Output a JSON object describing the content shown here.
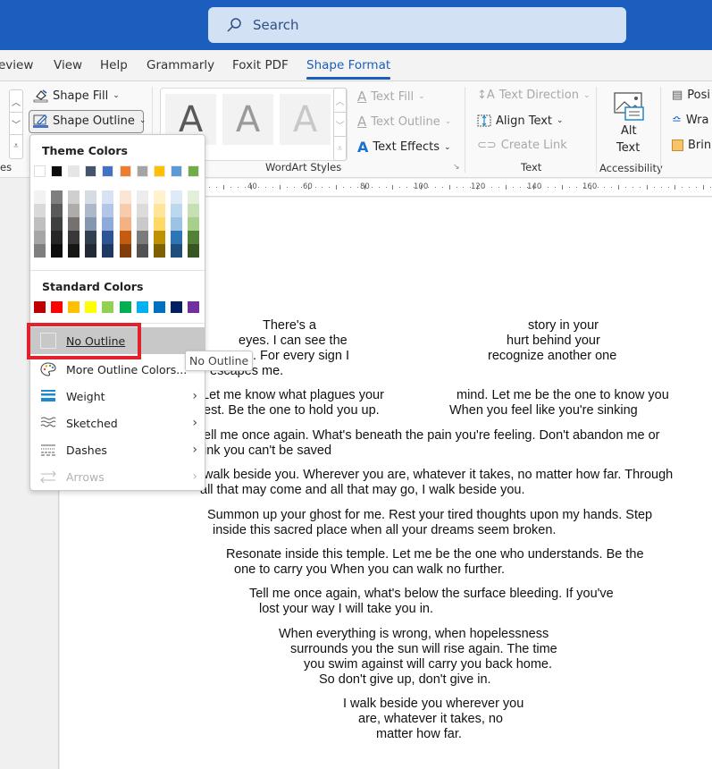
{
  "titlebar": {
    "search_placeholder": "Search"
  },
  "tabs": [
    {
      "label": "Review",
      "visible_label": "eview"
    },
    {
      "label": "View"
    },
    {
      "label": "Help"
    },
    {
      "label": "Grammarly"
    },
    {
      "label": "Foxit PDF"
    },
    {
      "label": "Shape Format",
      "active": true
    }
  ],
  "ribbon": {
    "shape_fill": "Shape Fill",
    "shape_outline": "Shape Outline",
    "shape_styles_label_partial": "es",
    "wordart_styles": {
      "label": "WordArt Styles",
      "samples": [
        "A",
        "A",
        "A"
      ]
    },
    "text_fill": "Text Fill",
    "text_outline": "Text Outline",
    "text_effects": "Text Effects",
    "text_direction": "Text Direction",
    "align_text": "Align Text",
    "create_link": "Create Link",
    "text_group_label": "Text",
    "alt_text_line1": "Alt",
    "alt_text_line2": "Text",
    "accessibility_label": "Accessibility",
    "position": "Posi",
    "wrap_text": "Wra",
    "bring_forward": "Brin"
  },
  "ruler": {
    "labels": [
      "40",
      "60",
      "80",
      "100",
      "120",
      "140",
      "160"
    ]
  },
  "dropdown": {
    "theme_colors_heading": "Theme Colors",
    "theme_colors": [
      "#ffffff",
      "#0d0d0d",
      "#e7e6e6",
      "#44546a",
      "#4472c4",
      "#ed7d31",
      "#a5a5a5",
      "#ffc000",
      "#5b9bd5",
      "#70ad47"
    ],
    "theme_shades": [
      [
        "#f2f2f2",
        "#d9d9d9",
        "#bfbfbf",
        "#a6a6a6",
        "#7f7f7f"
      ],
      [
        "#7f7f7f",
        "#595959",
        "#3f3f3f",
        "#262626",
        "#0d0d0d"
      ],
      [
        "#d0cece",
        "#aeabab",
        "#757171",
        "#3a3838",
        "#171616"
      ],
      [
        "#d6dce4",
        "#adb9ca",
        "#8497b0",
        "#323f4f",
        "#222a35"
      ],
      [
        "#d9e2f3",
        "#b4c6e7",
        "#8eaadb",
        "#2f5496",
        "#1f3864"
      ],
      [
        "#fbe5d5",
        "#f7cbac",
        "#f4b183",
        "#c55a11",
        "#833c0b"
      ],
      [
        "#ededed",
        "#dbdbdb",
        "#c9c9c9",
        "#7b7b7b",
        "#525252"
      ],
      [
        "#fff2cc",
        "#fee599",
        "#ffd965",
        "#bf9000",
        "#7f6000"
      ],
      [
        "#deeaf6",
        "#bdd7ee",
        "#9cc3e5",
        "#2e75b5",
        "#1e4e79"
      ],
      [
        "#e2efd9",
        "#c5e0b3",
        "#a8d08d",
        "#538135",
        "#375623"
      ]
    ],
    "standard_colors_heading": "Standard Colors",
    "standard_colors": [
      "#c00000",
      "#ff0000",
      "#ffc000",
      "#ffff00",
      "#92d050",
      "#00b050",
      "#00b0f0",
      "#0070c0",
      "#002060",
      "#7030a0"
    ],
    "no_outline": "No Outline",
    "more_outline_colors": "More Outline Colors...",
    "weight": "Weight",
    "sketched": "Sketched",
    "dashes": "Dashes",
    "arrows": "Arrows"
  },
  "tooltip": "No Outline",
  "document": {
    "lines": [
      "There's a",
      "story in your",
      "eyes. I can see the",
      "hurt behind your",
      ". For every sign I",
      "recognize another one",
      "escapes me.",
      "Let me know what plagues your",
      "mind. Let me be the one to know you",
      "est. Be the one to hold you up.",
      "When you feel like you're sinking",
      "ell me once again. What's beneath the pain you're feeling. Don't abandon me or",
      "ink you can't be saved",
      "walk beside you. Wherever you are, whatever it takes, no matter how far. Through",
      "all that may come and all that may go, I walk beside you.",
      "Summon up your ghost for me. Rest your tired thoughts upon my hands. Step",
      "inside this sacred place when all your dreams seem broken.",
      "Resonate inside this temple. Let me be the one who understands. Be the",
      "one to carry you When you can walk no further.",
      "Tell me once again, what's below the surface bleeding. If you've",
      "lost your way I will take you in.",
      "When everything is wrong, when hopelessness",
      "surrounds you the sun will rise again. The time",
      "you swim against will carry you back home.",
      "So don't give up, don't give in.",
      "I walk beside you wherever you",
      "are, whatever it takes, no",
      "matter how far."
    ]
  }
}
